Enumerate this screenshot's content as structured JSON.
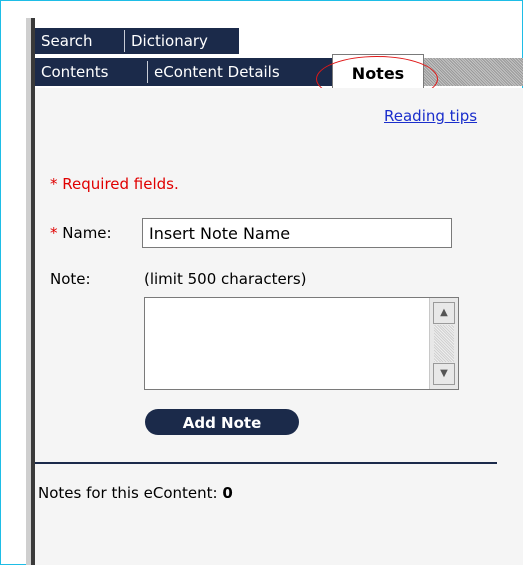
{
  "tabs_row1": [
    {
      "label": "Search"
    },
    {
      "label": "Dictionary"
    }
  ],
  "tabs_row2": [
    {
      "label": "Contents"
    },
    {
      "label": "eContent Details"
    }
  ],
  "active_tab": {
    "label": "Notes"
  },
  "links": {
    "reading_tips": "Reading tips"
  },
  "form": {
    "required_marker": "*",
    "required_text": "Required fields.",
    "name_label": "Name:",
    "name_value": "Insert Note Name",
    "note_label": "Note:",
    "note_hint": "(limit 500 characters)",
    "note_value": "",
    "submit_label": "Add Note"
  },
  "notes_summary": {
    "label": "Notes for this eContent:",
    "count": "0"
  },
  "icons": {
    "scroll_up": "scroll-up-arrow-icon",
    "scroll_down": "scroll-down-arrow-icon"
  },
  "colors": {
    "tab_background": "#1b2a4a",
    "required_red": "#e00000",
    "link_blue": "#1a2ecc",
    "highlight_red": "#e01818",
    "frame_border": "#1ebde6"
  }
}
